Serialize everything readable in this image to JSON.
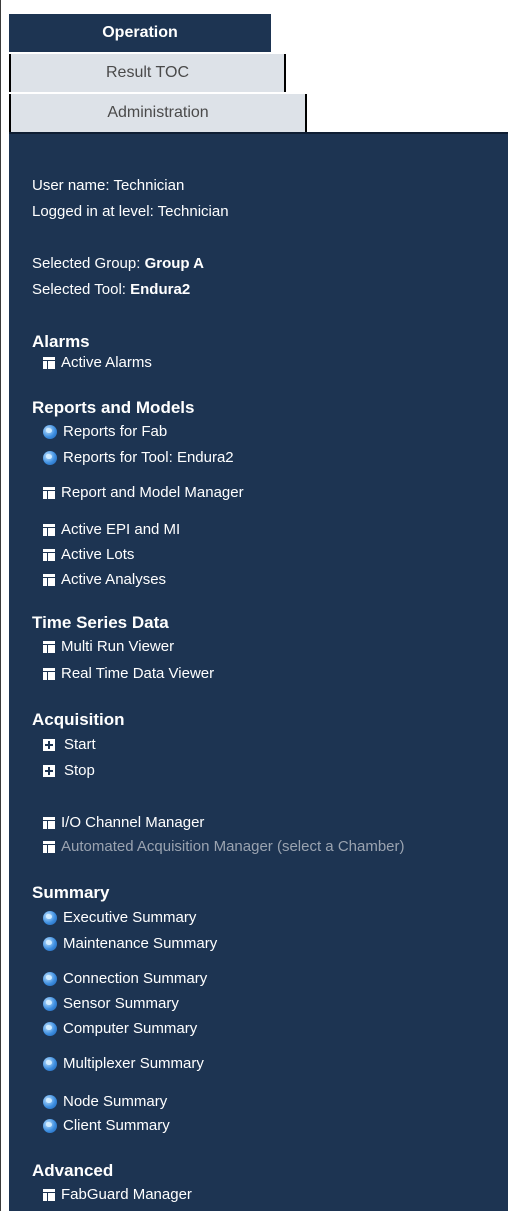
{
  "tabs": [
    {
      "label": "Operation",
      "active": true
    },
    {
      "label": "Result TOC",
      "active": false
    },
    {
      "label": "Administration",
      "active": false
    }
  ],
  "session": {
    "user_name_label": "User name:",
    "user_name": "Technician",
    "level_label": "Logged in at level:",
    "level": "Technician",
    "group_label": "Selected Group:",
    "group": "Group A",
    "tool_label": "Selected Tool:",
    "tool": "Endura2"
  },
  "sections": {
    "alarms": {
      "title": "Alarms",
      "items": [
        "Active Alarms"
      ]
    },
    "reports": {
      "title": "Reports and Models",
      "items": [
        "Reports for Fab",
        "Reports for Tool: Endura2",
        "Report and Model Manager",
        "Active EPI and MI",
        "Active Lots",
        "Active Analyses"
      ]
    },
    "timeseries": {
      "title": "Time Series Data",
      "items": [
        "Multi Run Viewer",
        "Real Time Data Viewer"
      ]
    },
    "acquisition": {
      "title": "Acquisition",
      "items": [
        "Start",
        "Stop",
        "I/O Channel Manager",
        "Automated Acquisition Manager (select a Chamber)"
      ]
    },
    "summary": {
      "title": "Summary",
      "items": [
        "Executive Summary",
        "Maintenance Summary",
        "Connection Summary",
        "Sensor Summary",
        "Computer Summary",
        "Multiplexer Summary",
        "Node Summary",
        "Client Summary"
      ]
    },
    "advanced": {
      "title": "Advanced",
      "items": [
        "FabGuard Manager"
      ]
    }
  },
  "colors": {
    "panel_bg": "#1d3452",
    "tab_inactive_bg": "#dde2e8",
    "text": "#ffffff",
    "disabled_text": "#9aa3b0"
  }
}
